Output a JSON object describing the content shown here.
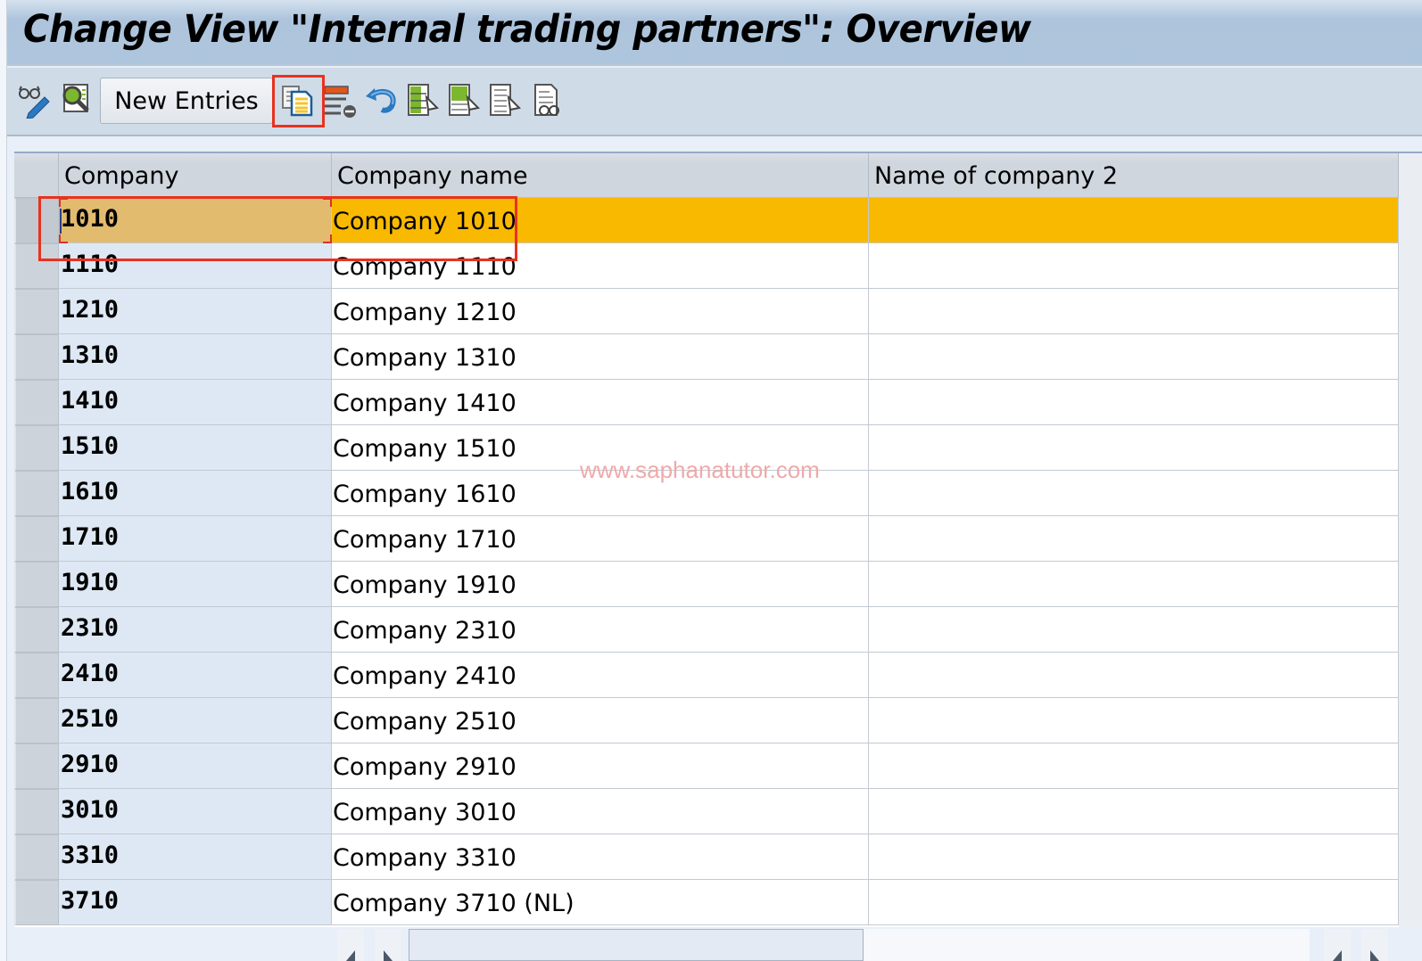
{
  "window": {
    "title": "Change View \"Internal trading partners\": Overview"
  },
  "toolbar": {
    "buttons": [
      {
        "id": "display-change",
        "icon": "glasses-pencil-icon",
        "tooltip": "Display/Change"
      },
      {
        "id": "select-detail",
        "icon": "magnifier-details-icon",
        "tooltip": "Details"
      },
      {
        "id": "new-entries",
        "label": "New Entries"
      },
      {
        "id": "copy-as",
        "icon": "copy-documents-icon",
        "tooltip": "Copy As...",
        "highlighted": true
      },
      {
        "id": "delete",
        "icon": "delete-row-icon",
        "tooltip": "Delete"
      },
      {
        "id": "undo",
        "icon": "undo-arrow-icon",
        "tooltip": "Undo Change"
      },
      {
        "id": "select-all",
        "icon": "select-all-icon",
        "tooltip": "Select All"
      },
      {
        "id": "select-block",
        "icon": "select-block-icon",
        "tooltip": "Select Block"
      },
      {
        "id": "deselect-all",
        "icon": "deselect-all-icon",
        "tooltip": "Deselect All"
      },
      {
        "id": "print",
        "icon": "print-document-icon",
        "tooltip": "Print Field List"
      }
    ],
    "new_entries_label": "New Entries"
  },
  "table": {
    "columns": [
      "Company",
      "Company name",
      "Name of company 2"
    ],
    "selected_row": 0,
    "rows": [
      {
        "company": "1010",
        "name": "Company 1010",
        "name2": ""
      },
      {
        "company": "1110",
        "name": "Company 1110",
        "name2": ""
      },
      {
        "company": "1210",
        "name": "Company 1210",
        "name2": ""
      },
      {
        "company": "1310",
        "name": "Company 1310",
        "name2": ""
      },
      {
        "company": "1410",
        "name": "Company 1410",
        "name2": ""
      },
      {
        "company": "1510",
        "name": "Company 1510",
        "name2": ""
      },
      {
        "company": "1610",
        "name": "Company 1610",
        "name2": ""
      },
      {
        "company": "1710",
        "name": "Company 1710",
        "name2": ""
      },
      {
        "company": "1910",
        "name": "Company 1910",
        "name2": ""
      },
      {
        "company": "2310",
        "name": "Company 2310",
        "name2": ""
      },
      {
        "company": "2410",
        "name": "Company 2410",
        "name2": ""
      },
      {
        "company": "2510",
        "name": "Company 2510",
        "name2": ""
      },
      {
        "company": "2910",
        "name": "Company 2910",
        "name2": ""
      },
      {
        "company": "3010",
        "name": "Company 3010",
        "name2": ""
      },
      {
        "company": "3310",
        "name": "Company 3310",
        "name2": ""
      },
      {
        "company": "3710",
        "name": "Company 3710 (NL)",
        "name2": ""
      }
    ]
  },
  "watermark": "www.saphanatutor.com",
  "colors": {
    "selected_row": "#f9b900",
    "selected_key_cell": "#e3bb6e",
    "key_column": "#dde8f4",
    "annotation_red": "#e8321f"
  }
}
